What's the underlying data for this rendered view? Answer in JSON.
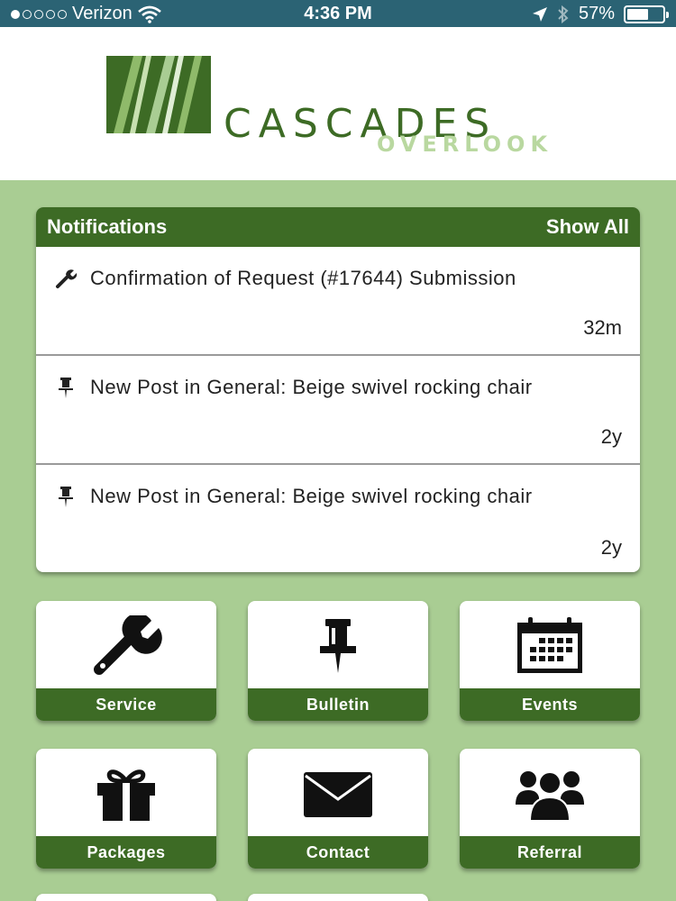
{
  "status_bar": {
    "carrier": "Verizon",
    "time": "4:36 PM",
    "battery_percent": "57%",
    "battery_level": 0.57
  },
  "header": {
    "logo_word": "CASCADES",
    "logo_sub": "OVERLOOK"
  },
  "notifications": {
    "title": "Notifications",
    "show_all": "Show All",
    "items": [
      {
        "icon": "wrench-icon",
        "text": "Confirmation of Request (#17644) Submission",
        "age": "32m"
      },
      {
        "icon": "pushpin-icon",
        "text": "New Post in General: Beige swivel rocking chair",
        "age": "2y"
      },
      {
        "icon": "pushpin-icon",
        "text": "New Post in General: Beige swivel rocking chair",
        "age": "2y"
      }
    ]
  },
  "tiles": [
    {
      "label": "Service",
      "icon": "wrench-icon"
    },
    {
      "label": "Bulletin",
      "icon": "pushpin-icon"
    },
    {
      "label": "Events",
      "icon": "calendar-icon"
    },
    {
      "label": "Packages",
      "icon": "gift-icon"
    },
    {
      "label": "Contact",
      "icon": "envelope-icon"
    },
    {
      "label": "Referral",
      "icon": "group-icon"
    }
  ],
  "colors": {
    "brand_green": "#3d6b25",
    "light_green": "#a9cd93",
    "status_bar": "#2b6374"
  }
}
